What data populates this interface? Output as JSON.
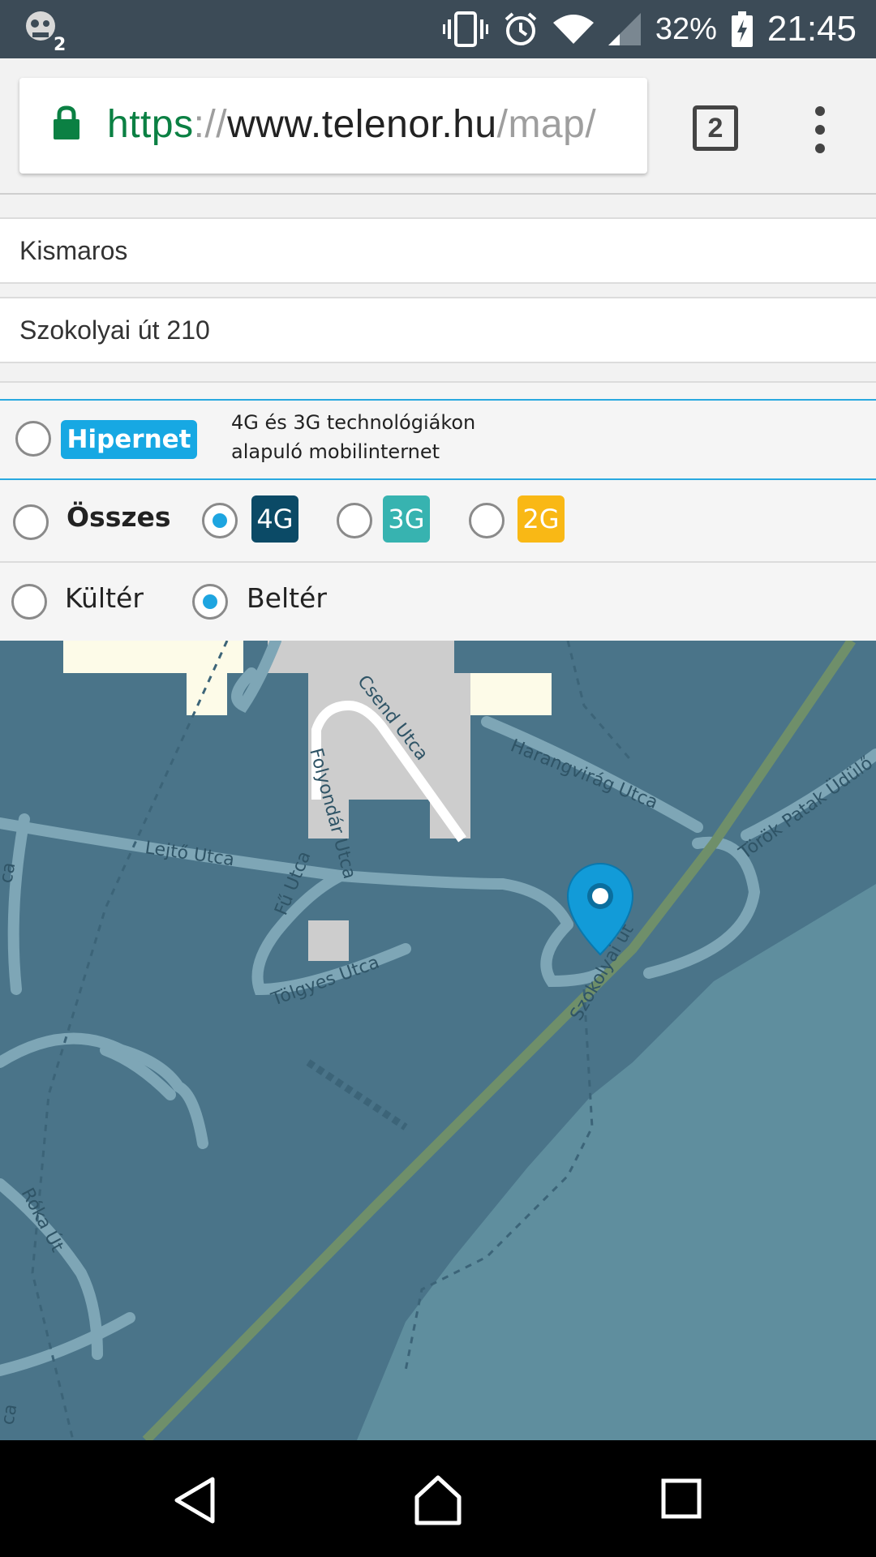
{
  "status_bar": {
    "notification_icon": "zombie-app-icon",
    "battery_percent": "32%",
    "time": "21:45",
    "icons": [
      "vibrate-icon",
      "alarm-icon",
      "wifi-icon",
      "signal-icon",
      "battery-charging-icon"
    ]
  },
  "browser": {
    "url_scheme": "https",
    "url_separator": "://",
    "url_host": "www.telenor.hu",
    "url_path": "/map/",
    "tab_count": "2"
  },
  "form": {
    "city": "Kismaros",
    "address": "Szokolyai út 210"
  },
  "filters": {
    "hipernet_label": "Hipernet",
    "hipernet_desc_line1": "4G és 3G technológiákon",
    "hipernet_desc_line2": "alapuló mobilinternet",
    "all_label": "Összes",
    "tech_4g": "4G",
    "tech_3g": "3G",
    "tech_2g": "2G",
    "selected_tech": "4G",
    "outdoor_label": "Kültér",
    "indoor_label": "Beltér",
    "selected_place": "Beltér"
  },
  "map": {
    "streets": [
      "Csend Utca",
      "Folyondár Utca",
      "Harangvirág Utca",
      "Lejtő Utca",
      "Fű Utca",
      "Tölgyes Utca",
      "Szokolyai út",
      "Török Patak Üdülő",
      "Róka Út",
      "ca",
      "ca"
    ],
    "colors": {
      "coverage": "#4a7489",
      "light": "#5f8e9e",
      "road": "#7ea6b6",
      "main_road": "#6f8f6a"
    }
  },
  "nav": {
    "icons": [
      "back-icon",
      "home-icon",
      "recents-icon"
    ]
  }
}
